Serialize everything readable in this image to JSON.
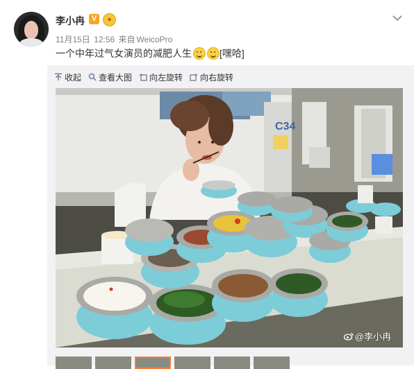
{
  "user": {
    "name": "李小冉",
    "verified_badge": "V",
    "vip_badge": "会员"
  },
  "meta": {
    "date": "11月15日",
    "time": "12:56",
    "source_prefix": "来自",
    "source": "WeicoPro"
  },
  "post": {
    "text": "一个中年过气女演员的减肥人生",
    "tag": "[嘿哈]"
  },
  "toolbar": {
    "collapse": "收起",
    "view_large": "查看大图",
    "rotate_left": "向左旋转",
    "rotate_right": "向右旋转"
  },
  "photo": {
    "watermark": "@李小冉",
    "truck_label": "C34"
  },
  "colors": {
    "accent": "#fa7d3c",
    "meta_gray": "#808080",
    "lunchbox_blue": "#6fc3d1"
  }
}
